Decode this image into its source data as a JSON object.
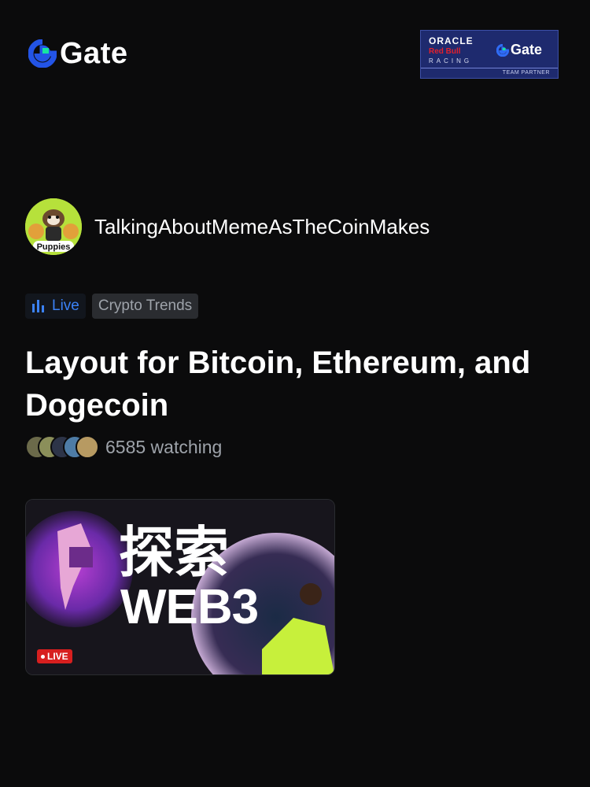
{
  "brand": {
    "name": "Gate",
    "color": "#2354e6",
    "accent": "#17e5a1"
  },
  "partner_badge": {
    "line1": "ORACLE",
    "line2": "Red Bull",
    "line3": "RACING",
    "brand": "Gate",
    "caption": "TEAM PARTNER"
  },
  "author": {
    "name": "TalkingAboutMemeAsTheCoinMakes",
    "avatar_label": "Puppies"
  },
  "tags": {
    "live": "Live",
    "topic": "Crypto Trends"
  },
  "stream": {
    "title": "Layout for Bitcoin, Ethereum, and Dogecoin",
    "watching": "6585 watching"
  },
  "thumbnail": {
    "headline_cn": "探索",
    "headline_en": "WEB3",
    "badge": "LIVE"
  },
  "colors": {
    "live_blue": "#3b82f6",
    "live_red": "#d71f1f",
    "muted": "#9ea3aa"
  }
}
